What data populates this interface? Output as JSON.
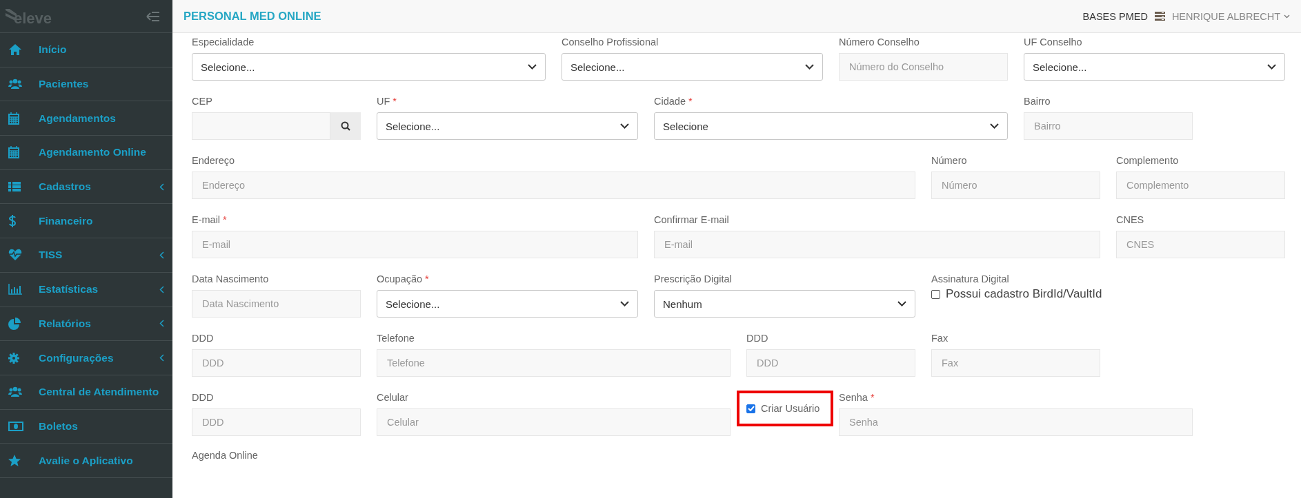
{
  "header": {
    "title": "PERSONAL MED ONLINE",
    "base": "BASES PMED",
    "user": "HENRIQUE ALBRECHT"
  },
  "sidebar": {
    "logo": "eleve",
    "items": [
      {
        "label": "Início",
        "kind": "link"
      },
      {
        "label": "Pacientes",
        "kind": "link"
      },
      {
        "label": "Agendamentos",
        "kind": "link"
      },
      {
        "label": "Agendamento Online",
        "kind": "link"
      },
      {
        "label": "Cadastros",
        "kind": "submenu"
      },
      {
        "label": "Financeiro",
        "kind": "link"
      },
      {
        "label": "TISS",
        "kind": "submenu"
      },
      {
        "label": "Estatísticas",
        "kind": "submenu"
      },
      {
        "label": "Relatórios",
        "kind": "submenu"
      },
      {
        "label": "Configurações",
        "kind": "submenu"
      },
      {
        "label": "Central de Atendimento",
        "kind": "link"
      },
      {
        "label": "Boletos",
        "kind": "link"
      },
      {
        "label": "Avalie o Aplicativo",
        "kind": "link"
      }
    ]
  },
  "form": {
    "rows": [
      [
        {
          "label": "Especialidade",
          "kind": "select",
          "value": "Selecione..."
        },
        {
          "label": "Conselho Profissional",
          "kind": "select",
          "value": "Selecione..."
        },
        {
          "label": "Número Conselho",
          "kind": "input",
          "placeholder": "Número do Conselho"
        },
        {
          "label": "UF Conselho",
          "kind": "select",
          "value": "Selecione..."
        }
      ],
      [
        {
          "label": "CEP",
          "kind": "search"
        },
        {
          "label": "UF",
          "required_mark": "*",
          "kind": "select",
          "value": "Selecione..."
        },
        {
          "label": "Cidade",
          "required_mark": "*",
          "kind": "select",
          "value": "Selecione"
        },
        {
          "label": "Bairro",
          "kind": "input",
          "placeholder": "Bairro"
        }
      ],
      [
        {
          "label": "Endereço",
          "kind": "input",
          "placeholder": "Endereço"
        },
        {
          "label": "Número",
          "kind": "input",
          "placeholder": "Número"
        },
        {
          "label": "Complemento",
          "kind": "input",
          "placeholder": "Complemento"
        }
      ],
      [
        {
          "label": "E-mail",
          "required_mark": "*",
          "kind": "input",
          "placeholder": "E-mail"
        },
        {
          "label": "Confirmar E-mail",
          "kind": "input",
          "placeholder": "E-mail"
        },
        {
          "label": "CNES",
          "kind": "input",
          "placeholder": "CNES"
        }
      ],
      [
        {
          "label": "Data Nascimento",
          "kind": "input",
          "placeholder": "Data Nascimento"
        },
        {
          "label": "Ocupação",
          "required_mark": "*",
          "kind": "select",
          "value": "Selecione..."
        },
        {
          "label": "Prescrição Digital",
          "kind": "select",
          "value": "Nenhum"
        },
        {
          "label": "Assinatura Digital",
          "kind": "checkbox",
          "text": "Possui cadastro BirdId/VaultId",
          "checked": false
        }
      ],
      [
        {
          "label": "DDD",
          "kind": "input",
          "placeholder": "DDD"
        },
        {
          "label": "Telefone",
          "kind": "input",
          "placeholder": "Telefone"
        },
        {
          "label": "DDD",
          "kind": "input",
          "placeholder": "DDD"
        },
        {
          "label": "Fax",
          "kind": "input",
          "placeholder": "Fax"
        }
      ],
      [
        {
          "label": "DDD",
          "kind": "input",
          "placeholder": "DDD"
        },
        {
          "label": "Celular",
          "kind": "input",
          "placeholder": "Celular"
        },
        {
          "kind": "checkbox",
          "text": "Criar Usuário",
          "checked": true,
          "highlighted": true
        },
        {
          "label": "Senha",
          "required_mark": "*",
          "kind": "input",
          "placeholder": "Senha"
        }
      ],
      [
        {
          "label": "Agenda Online",
          "kind": "heading"
        }
      ]
    ]
  }
}
